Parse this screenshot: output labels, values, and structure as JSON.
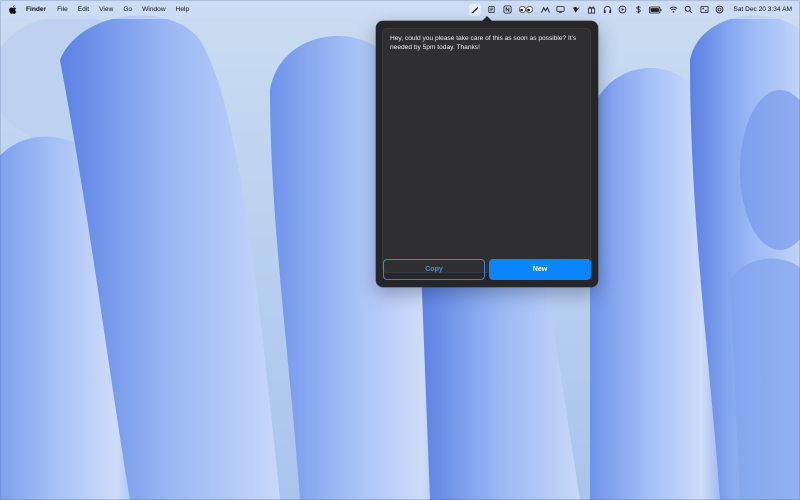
{
  "menubar": {
    "apple_icon": "apple-logo-icon",
    "menus": [
      {
        "label": "Finder",
        "bold": true
      },
      {
        "label": "Edit"
      },
      {
        "label": "File"
      },
      {
        "label": "View"
      },
      {
        "label": "Go"
      },
      {
        "label": "Window"
      },
      {
        "label": "Help"
      }
    ],
    "status_icons": [
      "pen-nib-icon",
      "list-icon",
      "n-square-icon",
      "eyes-icon",
      "mountain-icon",
      "monitor-icon",
      "checkmark-star-icon",
      "gift-icon",
      "headphones-icon",
      "play-circle-icon",
      "dollar-flag-icon",
      "battery-icon",
      "wifi-icon",
      "spotlight-search-icon",
      "control-center-icon",
      "siri-icon"
    ],
    "clock": "Sat Dec 20  3:34 AM"
  },
  "popover": {
    "message": "Hey, could you please take care of this as soon as possible? It's needed by 5pm today. Thanks!",
    "copy_label": "Copy",
    "new_label": "New",
    "accent_color": "#0a84ff"
  }
}
